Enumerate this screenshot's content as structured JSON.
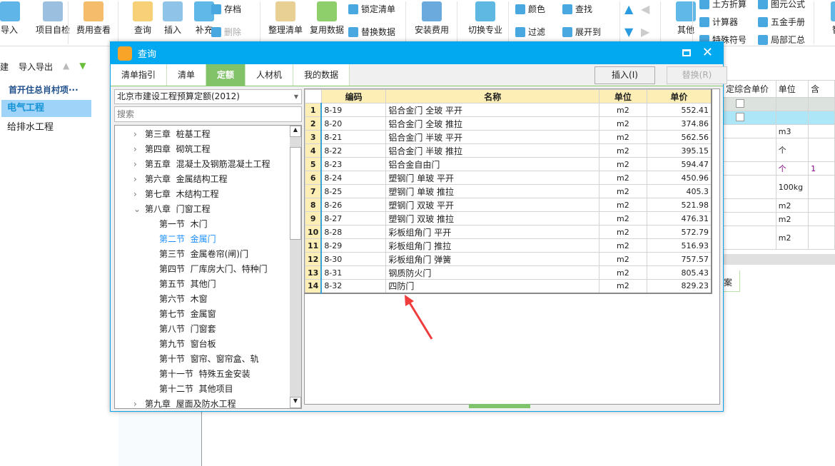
{
  "toolbar": {
    "buttons": [
      "导入",
      "项目自检",
      "费用查看",
      "查询",
      "插入",
      "补充",
      "整理清单",
      "复用数据",
      "安装费用",
      "切换专业",
      "其他",
      "智能"
    ],
    "small": [
      "存档",
      "删除",
      "锁定清单",
      "替换数据",
      "颜色",
      "查找",
      "过滤",
      "展开到",
      "土方折算",
      "图元公式",
      "计算器",
      "五金手册",
      "特殊符号",
      "局部汇总"
    ]
  },
  "left": {
    "toolbar": [
      "建",
      "导入导出"
    ],
    "project": "首开住总肖村项···",
    "items": [
      "电气工程",
      "给排水工程"
    ]
  },
  "background_grid": {
    "headers": [
      "定综合单价",
      "单位",
      "含"
    ],
    "units": [
      "",
      "",
      "m3",
      "个",
      "个",
      "100kg",
      "m2",
      "m2",
      "m2"
    ],
    "purple_value": "1",
    "tab": "案"
  },
  "dialog": {
    "title": "查询",
    "tabs": [
      "清单指引",
      "清单",
      "定额",
      "人材机",
      "我的数据"
    ],
    "active_tab": "定额",
    "insert_button": "插入(I)",
    "replace_button": "替换(R)",
    "quota_select": "北京市建设工程预算定额(2012)",
    "search_placeholder": "搜索",
    "tree": [
      {
        "label": "第三章  桩基工程",
        "level": 0,
        "expander": "collapsed"
      },
      {
        "label": "第四章  砌筑工程",
        "level": 0,
        "expander": "collapsed"
      },
      {
        "label": "第五章  混凝土及钢筋混凝土工程",
        "level": 0,
        "expander": "collapsed"
      },
      {
        "label": "第六章  金属结构工程",
        "level": 0,
        "expander": "collapsed"
      },
      {
        "label": "第七章  木结构工程",
        "level": 0,
        "expander": "collapsed"
      },
      {
        "label": "第八章  门窗工程",
        "level": 0,
        "expander": "expanded"
      },
      {
        "label": "第一节  木门",
        "level": 1
      },
      {
        "label": "第二节  金属门",
        "level": 1,
        "selected": true
      },
      {
        "label": "第三节  金属卷帘(闸)门",
        "level": 1
      },
      {
        "label": "第四节  厂库房大门、特种门",
        "level": 1
      },
      {
        "label": "第五节  其他门",
        "level": 1
      },
      {
        "label": "第六节  木窗",
        "level": 1
      },
      {
        "label": "第七节  金属窗",
        "level": 1
      },
      {
        "label": "第八节  门窗套",
        "level": 1
      },
      {
        "label": "第九节  窗台板",
        "level": 1
      },
      {
        "label": "第十节  窗帘、窗帘盒、轨",
        "level": 1
      },
      {
        "label": "第十一节  特殊五金安装",
        "level": 1
      },
      {
        "label": "第十二节  其他项目",
        "level": 1
      },
      {
        "label": "第九章  屋面及防水工程",
        "level": 0,
        "expander": "collapsed"
      }
    ],
    "columns": [
      "编码",
      "名称",
      "单位",
      "单价"
    ],
    "rows": [
      [
        "1",
        "8-19",
        "铝合金门 全玻 平开",
        "m2",
        "552.41"
      ],
      [
        "2",
        "8-20",
        "铝合金门 全玻 推拉",
        "m2",
        "374.86"
      ],
      [
        "3",
        "8-21",
        "铝合金门 半玻 平开",
        "m2",
        "562.56"
      ],
      [
        "4",
        "8-22",
        "铝合金门 半玻 推拉",
        "m2",
        "395.15"
      ],
      [
        "5",
        "8-23",
        "铝合金自由门",
        "m2",
        "594.47"
      ],
      [
        "6",
        "8-24",
        "塑钢门 单玻 平开",
        "m2",
        "450.96"
      ],
      [
        "7",
        "8-25",
        "塑钢门 单玻 推拉",
        "m2",
        "405.3"
      ],
      [
        "8",
        "8-26",
        "塑钢门 双玻 平开",
        "m2",
        "521.98"
      ],
      [
        "9",
        "8-27",
        "塑钢门 双玻 推拉",
        "m2",
        "476.31"
      ],
      [
        "10",
        "8-28",
        "彩板组角门 平开",
        "m2",
        "572.79"
      ],
      [
        "11",
        "8-29",
        "彩板组角门 推拉",
        "m2",
        "516.93"
      ],
      [
        "12",
        "8-30",
        "彩板组角门 弹簧",
        "m2",
        "757.57"
      ],
      [
        "13",
        "8-31",
        "钢质防火门",
        "m2",
        "805.43"
      ],
      [
        "14",
        "8-32",
        "四防门",
        "m2",
        "829.23"
      ]
    ]
  },
  "colors": {
    "titlebar": "#03a9f0",
    "active_tab": "#82c36a",
    "header": "#fdeeb5",
    "selected_tree": "#1e90ff",
    "annotation_arrow": "#f03c3c"
  }
}
